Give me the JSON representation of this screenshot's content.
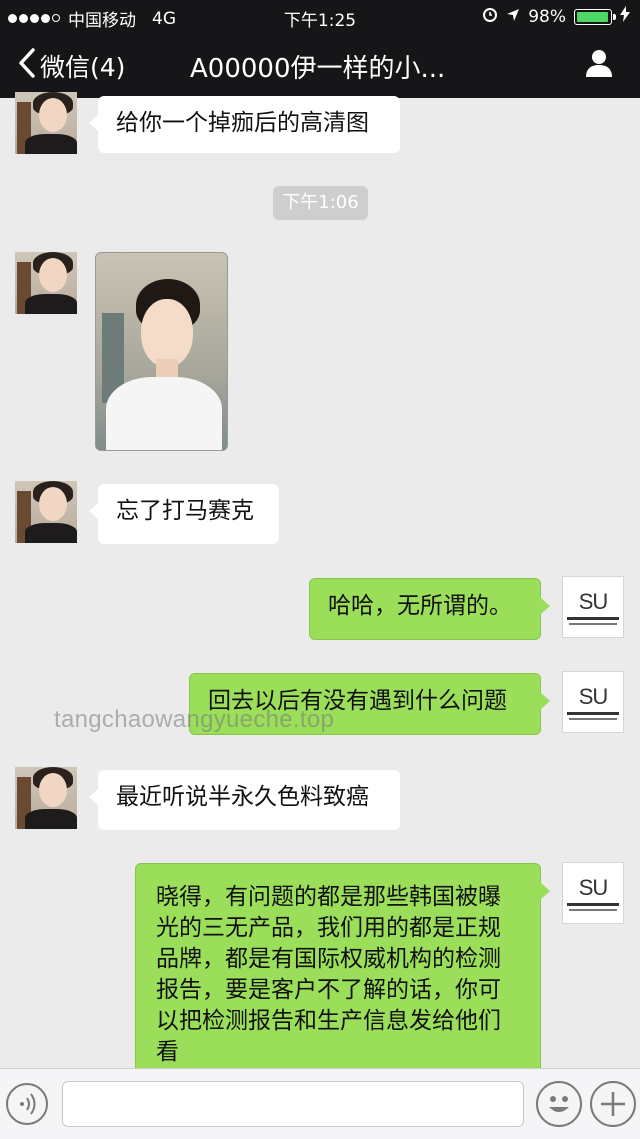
{
  "status_bar": {
    "carrier": "中国移动",
    "network": "4G",
    "time": "下午1:25",
    "battery_percent": "98%",
    "battery_level": 0.98
  },
  "nav": {
    "back_label": "微信(4)",
    "title": "A00000伊一样的小..."
  },
  "timestamp": "下午1:06",
  "messages": [
    {
      "side": "in",
      "text": "给你一个掉痂后的高清图"
    },
    {
      "side": "in",
      "type": "image"
    },
    {
      "side": "in",
      "text": "忘了打马赛克"
    },
    {
      "side": "out",
      "text": "哈哈，无所谓的。"
    },
    {
      "side": "out",
      "text": "回去以后有没有遇到什么问题"
    },
    {
      "side": "in",
      "text": "最近听说半永久色料致癌"
    },
    {
      "side": "out",
      "text": "晓得，有问题的都是那些韩国被曝光的三无产品，我们用的都是正规品牌，都是有国际权威机构的检测报告，要是客户不了解的话，你可以把检测报告和生产信息发给他们看"
    }
  ],
  "my_avatar_logo": "SU",
  "watermark": "tangchaowangyueche.top",
  "colors": {
    "header_bg": "#161619",
    "chat_bg": "#ebebeb",
    "out_bubble": "#9bde5a",
    "in_bubble": "#ffffff",
    "battery": "#4cd964"
  },
  "icons": {
    "back": "chevron-left-icon",
    "profile": "person-icon",
    "voice": "voice-icon",
    "emoji": "emoji-icon",
    "plus": "plus-icon"
  }
}
